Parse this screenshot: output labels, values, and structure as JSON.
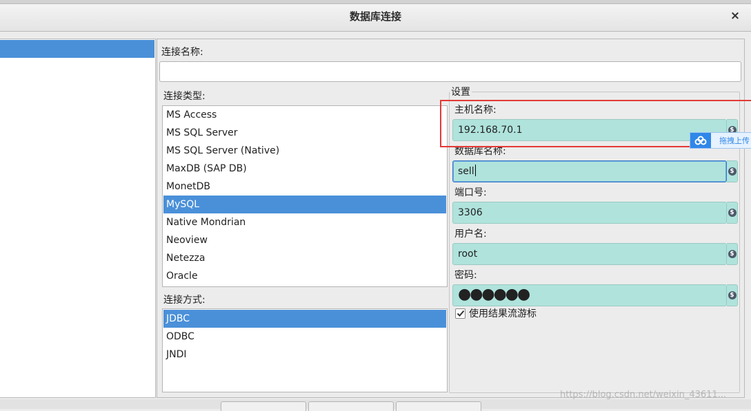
{
  "window": {
    "title": "数据库连接",
    "close_label": "×"
  },
  "connection_name": {
    "label": "连接名称:",
    "value": ""
  },
  "connection_type": {
    "label": "连接类型:",
    "items": [
      "MS Access",
      "MS SQL Server",
      "MS SQL Server (Native)",
      "MaxDB (SAP DB)",
      "MonetDB",
      "MySQL",
      "Native Mondrian",
      "Neoview",
      "Netezza",
      "Oracle"
    ],
    "selected": "MySQL"
  },
  "access_method": {
    "label": "连接方式:",
    "items": [
      "JDBC",
      "ODBC",
      "JNDI"
    ],
    "selected": "JDBC"
  },
  "settings": {
    "legend": "设置",
    "host_label": "主机名称:",
    "host_value": "192.168.70.1",
    "db_label": "数据库名称:",
    "db_value": "sell",
    "port_label": "端口号:",
    "port_value": "3306",
    "user_label": "用户名:",
    "user_value": "root",
    "password_label": "密码:",
    "password_value": "●●●●●●",
    "use_cursor_label": "使用结果流游标",
    "use_cursor_checked": true,
    "variable_button_symbol": "$"
  },
  "overlay": {
    "upload_text": "拖拽上传",
    "watermark": "https://blog.csdn.net/weixin_43611..."
  },
  "colors": {
    "selection": "#4a90d9",
    "field_bg": "#afe3dc",
    "highlight_box": "#e53935",
    "upload_blue": "#2f87e8"
  }
}
